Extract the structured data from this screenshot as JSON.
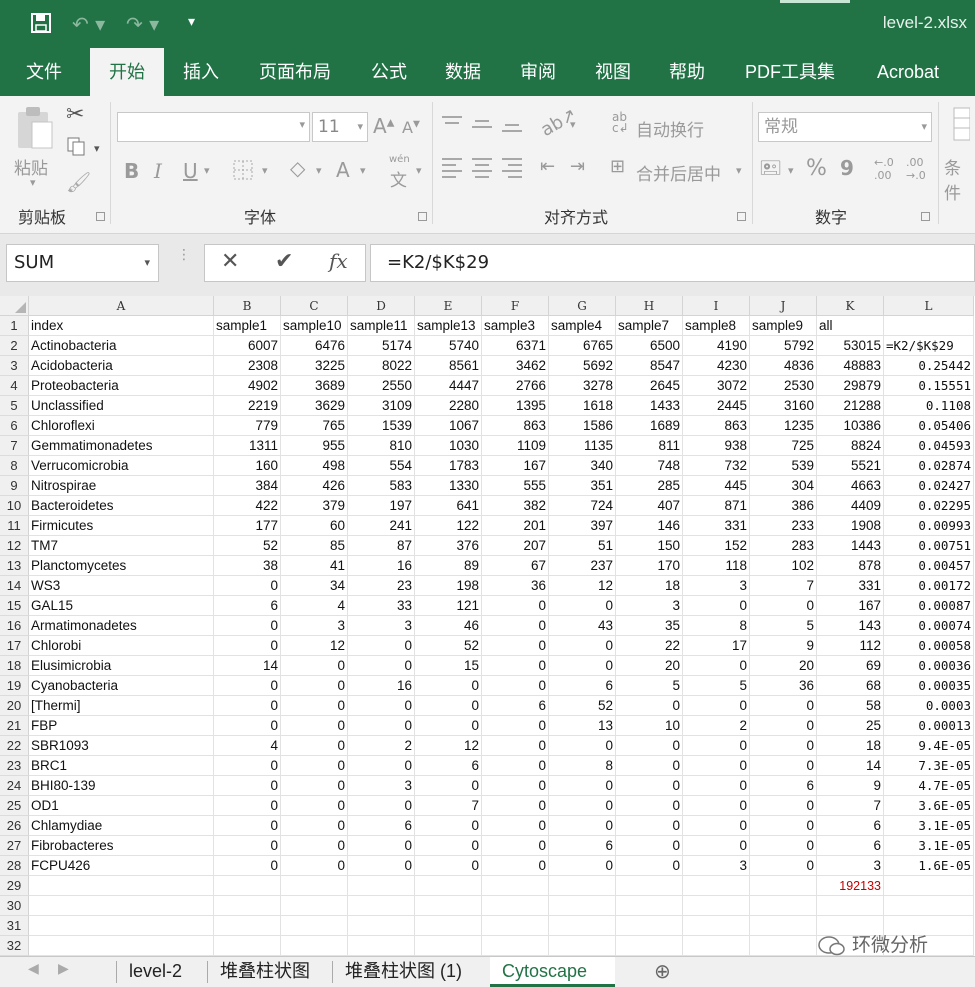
{
  "titlebar": {
    "filename": "level-2.xlsx",
    "save_icon": "save-icon",
    "undo_icon": "undo-icon",
    "redo_icon": "redo-icon",
    "customize_icon": "customize-quick-access-icon"
  },
  "ribbon_tabs": [
    "文件",
    "开始",
    "插入",
    "页面布局",
    "公式",
    "数据",
    "审阅",
    "视图",
    "帮助",
    "PDF工具集",
    "Acrobat"
  ],
  "active_tab": "开始",
  "ribbon": {
    "clipboard": {
      "label": "剪贴板",
      "paste_label": "粘贴"
    },
    "font": {
      "label": "字体",
      "font_name": "",
      "font_size": "11",
      "bold": "B",
      "italic": "I",
      "underline": "U",
      "font_color": "A",
      "phonetic": "wén",
      "phonetic_char": "文"
    },
    "alignment": {
      "label": "对齐方式",
      "wrap_text": "自动换行",
      "merge_center": "合并后居中"
    },
    "number": {
      "label": "数字",
      "format": "常规",
      "percent": "%",
      "comma": "9",
      "inc_decimal": "←.0\n.00",
      "dec_decimal": ".00\n→.0"
    },
    "styles": {
      "label": "条件"
    }
  },
  "formula_bar": {
    "name_box": "SUM",
    "formula": "=K2/$K$29",
    "cancel_icon": "✕",
    "enter_icon": "✔",
    "fx": "fx"
  },
  "columns": [
    "A",
    "B",
    "C",
    "D",
    "E",
    "F",
    "G",
    "H",
    "I",
    "J",
    "K",
    "L"
  ],
  "row_numbers": [
    "1",
    "2",
    "3",
    "4",
    "5",
    "6",
    "7",
    "8",
    "9",
    "10",
    "11",
    "12",
    "13",
    "14",
    "15",
    "16",
    "17",
    "18",
    "19",
    "20",
    "21",
    "22",
    "23",
    "24",
    "25",
    "26",
    "27",
    "28",
    "29",
    "30",
    "31",
    "32"
  ],
  "rows": [
    [
      "index",
      "sample1",
      "sample10",
      "sample11",
      "sample13",
      "sample3",
      "sample4",
      "sample7",
      "sample8",
      "sample9",
      "all",
      ""
    ],
    [
      "Actinobacteria",
      "6007",
      "6476",
      "5174",
      "5740",
      "6371",
      "6765",
      "6500",
      "4190",
      "5792",
      "53015",
      "=K2/$K$29"
    ],
    [
      "Acidobacteria",
      "2308",
      "3225",
      "8022",
      "8561",
      "3462",
      "5692",
      "8547",
      "4230",
      "4836",
      "48883",
      "0.25442"
    ],
    [
      "Proteobacteria",
      "4902",
      "3689",
      "2550",
      "4447",
      "2766",
      "3278",
      "2645",
      "3072",
      "2530",
      "29879",
      "0.15551"
    ],
    [
      "Unclassified",
      "2219",
      "3629",
      "3109",
      "2280",
      "1395",
      "1618",
      "1433",
      "2445",
      "3160",
      "21288",
      "0.1108"
    ],
    [
      "Chloroflexi",
      "779",
      "765",
      "1539",
      "1067",
      "863",
      "1586",
      "1689",
      "863",
      "1235",
      "10386",
      "0.05406"
    ],
    [
      "Gemmatimonadetes",
      "1311",
      "955",
      "810",
      "1030",
      "1109",
      "1135",
      "811",
      "938",
      "725",
      "8824",
      "0.04593"
    ],
    [
      "Verrucomicrobia",
      "160",
      "498",
      "554",
      "1783",
      "167",
      "340",
      "748",
      "732",
      "539",
      "5521",
      "0.02874"
    ],
    [
      "Nitrospirae",
      "384",
      "426",
      "583",
      "1330",
      "555",
      "351",
      "285",
      "445",
      "304",
      "4663",
      "0.02427"
    ],
    [
      "Bacteroidetes",
      "422",
      "379",
      "197",
      "641",
      "382",
      "724",
      "407",
      "871",
      "386",
      "4409",
      "0.02295"
    ],
    [
      "Firmicutes",
      "177",
      "60",
      "241",
      "122",
      "201",
      "397",
      "146",
      "331",
      "233",
      "1908",
      "0.00993"
    ],
    [
      "TM7",
      "52",
      "85",
      "87",
      "376",
      "207",
      "51",
      "150",
      "152",
      "283",
      "1443",
      "0.00751"
    ],
    [
      "Planctomycetes",
      "38",
      "41",
      "16",
      "89",
      "67",
      "237",
      "170",
      "118",
      "102",
      "878",
      "0.00457"
    ],
    [
      "WS3",
      "0",
      "34",
      "23",
      "198",
      "36",
      "12",
      "18",
      "3",
      "7",
      "331",
      "0.00172"
    ],
    [
      "GAL15",
      "6",
      "4",
      "33",
      "121",
      "0",
      "0",
      "3",
      "0",
      "0",
      "167",
      "0.00087"
    ],
    [
      "Armatimonadetes",
      "0",
      "3",
      "3",
      "46",
      "0",
      "43",
      "35",
      "8",
      "5",
      "143",
      "0.00074"
    ],
    [
      "Chlorobi",
      "0",
      "12",
      "0",
      "52",
      "0",
      "0",
      "22",
      "17",
      "9",
      "112",
      "0.00058"
    ],
    [
      "Elusimicrobia",
      "14",
      "0",
      "0",
      "15",
      "0",
      "0",
      "20",
      "0",
      "20",
      "69",
      "0.00036"
    ],
    [
      "Cyanobacteria",
      "0",
      "0",
      "16",
      "0",
      "0",
      "6",
      "5",
      "5",
      "36",
      "68",
      "0.00035"
    ],
    [
      "[Thermi]",
      "0",
      "0",
      "0",
      "0",
      "6",
      "52",
      "0",
      "0",
      "0",
      "58",
      "0.0003"
    ],
    [
      "FBP",
      "0",
      "0",
      "0",
      "0",
      "0",
      "13",
      "10",
      "2",
      "0",
      "25",
      "0.00013"
    ],
    [
      "SBR1093",
      "4",
      "0",
      "2",
      "12",
      "0",
      "0",
      "0",
      "0",
      "0",
      "18",
      "9.4E-05"
    ],
    [
      "BRC1",
      "0",
      "0",
      "0",
      "6",
      "0",
      "8",
      "0",
      "0",
      "0",
      "14",
      "7.3E-05"
    ],
    [
      "BHI80-139",
      "0",
      "0",
      "3",
      "0",
      "0",
      "0",
      "0",
      "0",
      "6",
      "9",
      "4.7E-05"
    ],
    [
      "OD1",
      "0",
      "0",
      "0",
      "7",
      "0",
      "0",
      "0",
      "0",
      "0",
      "7",
      "3.6E-05"
    ],
    [
      "Chlamydiae",
      "0",
      "0",
      "6",
      "0",
      "0",
      "0",
      "0",
      "0",
      "0",
      "6",
      "3.1E-05"
    ],
    [
      "Fibrobacteres",
      "0",
      "0",
      "0",
      "0",
      "0",
      "6",
      "0",
      "0",
      "0",
      "6",
      "3.1E-05"
    ],
    [
      "FCPU426",
      "0",
      "0",
      "0",
      "0",
      "0",
      "0",
      "0",
      "3",
      "0",
      "3",
      "1.6E-05"
    ],
    [
      "",
      "",
      "",
      "",
      "",
      "",
      "",
      "",
      "",
      "",
      "192133",
      ""
    ],
    [
      "",
      "",
      "",
      "",
      "",
      "",
      "",
      "",
      "",
      "",
      "",
      ""
    ],
    [
      "",
      "",
      "",
      "",
      "",
      "",
      "",
      "",
      "",
      "",
      "",
      ""
    ],
    [
      "",
      "",
      "",
      "",
      "",
      "",
      "",
      "",
      "",
      "",
      "",
      ""
    ]
  ],
  "sheet_tabs": [
    "level-2",
    "堆叠柱状图",
    "堆叠柱状图 (1)",
    "Cytoscape"
  ],
  "active_sheet": "Cytoscape",
  "watermark": "环微分析",
  "colors": {
    "excel_green": "#217346",
    "ribbon_bg": "#f3f3f3",
    "total_red": "#c00000"
  }
}
